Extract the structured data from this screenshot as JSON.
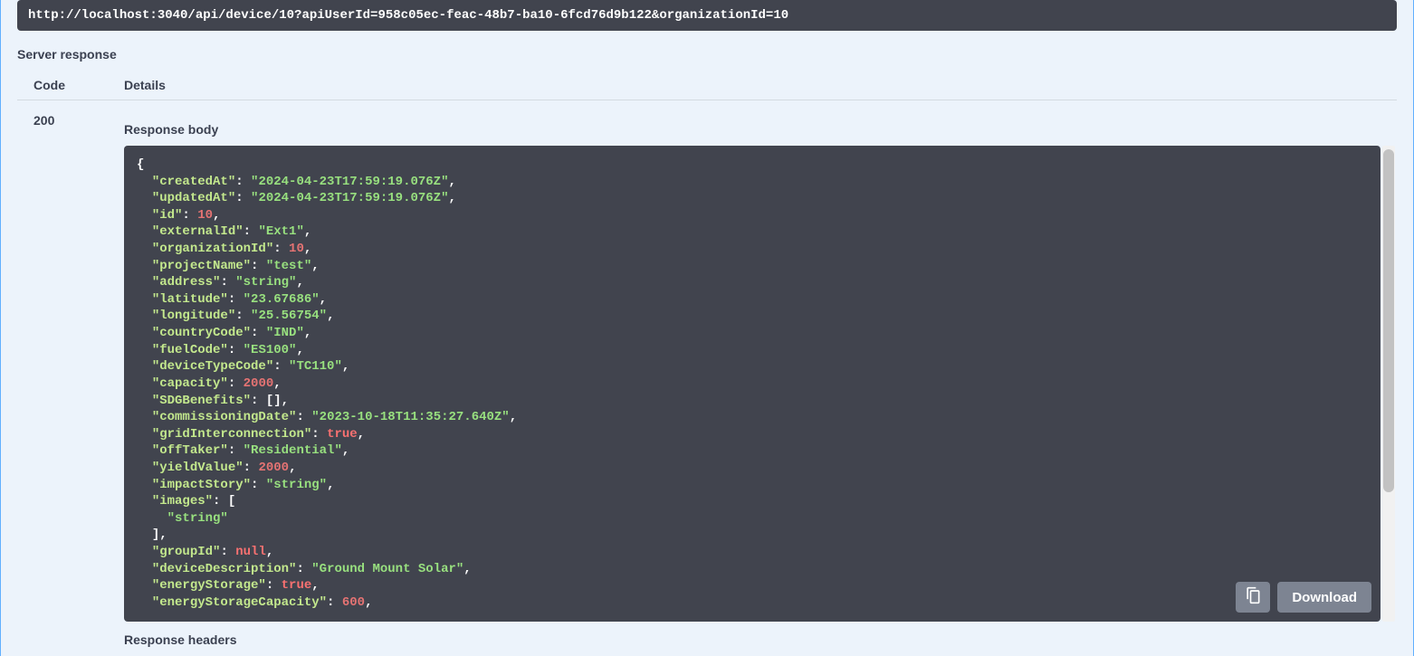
{
  "request_url": "http://localhost:3040/api/device/10?apiUserId=958c05ec-feac-48b7-ba10-6fcd76d9b122&organizationId=10",
  "labels": {
    "server_response": "Server response",
    "code": "Code",
    "details": "Details",
    "response_body": "Response body",
    "response_headers": "Response headers",
    "download": "Download"
  },
  "status_code": "200",
  "body": {
    "createdAt": "2024-04-23T17:59:19.076Z",
    "updatedAt": "2024-04-23T17:59:19.076Z",
    "id": 10,
    "externalId": "Ext1",
    "organizationId": 10,
    "projectName": "test",
    "address": "string",
    "latitude": "23.67686",
    "longitude": "25.56754",
    "countryCode": "IND",
    "fuelCode": "ES100",
    "deviceTypeCode": "TC110",
    "capacity": 2000,
    "SDGBenefits": [],
    "commissioningDate": "2023-10-18T11:35:27.640Z",
    "gridInterconnection": true,
    "offTaker": "Residential",
    "yieldValue": 2000,
    "impactStory": "string",
    "images": [
      "string"
    ],
    "groupId": null,
    "deviceDescription": "Ground Mount Solar",
    "energyStorage": true,
    "energyStorageCapacity": 600
  }
}
